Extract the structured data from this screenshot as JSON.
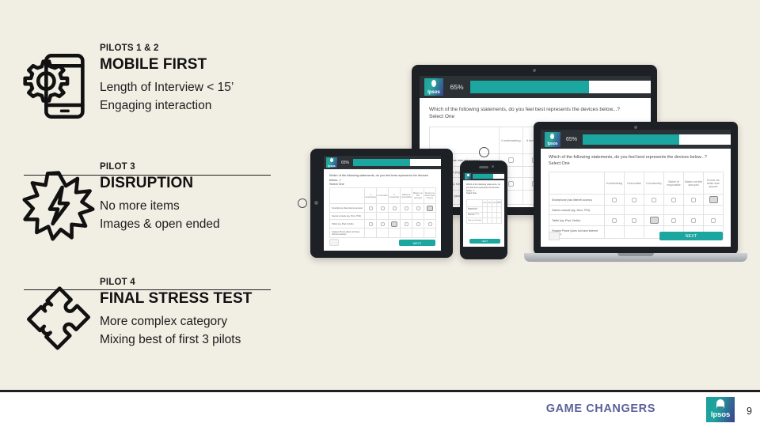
{
  "slide": {
    "background_color": "#F1EEE4",
    "page_number": "9"
  },
  "sections": [
    {
      "kicker": "PILOTS 1 & 2",
      "headline": "MOBILE FIRST",
      "body_line_1": "Length of Interview < 15’",
      "body_line_2": "Engaging interaction",
      "icon": "smartphone-gear-icon"
    },
    {
      "kicker": "PILOT 3",
      "headline": "DISRUPTION",
      "body_line_1": "No more items",
      "body_line_2": "Images & open ended",
      "icon": "starburst-lightning-icon"
    },
    {
      "kicker": "PILOT 4",
      "headline": "FINAL STRESS TEST",
      "body_line_1": "More complex category",
      "body_line_2": "Mixing best of first 3 pilots",
      "icon": "puzzle-pieces-icon"
    }
  ],
  "devices": {
    "survey": {
      "brand": "Ipsos",
      "progress_label": "65%",
      "progress_percent": 65,
      "question": "Which of the following statements, do you feel best represents the devices below...?",
      "instruction": "Select One",
      "columns": [
        "It entertaining",
        "It innovative",
        "It trustworthy",
        "Stable Hi responsible",
        "Makes me feel annoyed",
        "Knows me better than anyone"
      ],
      "rows": [
        "Smartphone (has internet access)",
        "Games console (eg. Xbox, PS4)",
        "Tablet (eg. iPad, Kindle)",
        "Feature Phone (does not have internet access)"
      ],
      "next_label": "NEXT",
      "accent_color": "#1BA6A0",
      "header_color": "#2C3136"
    },
    "items": [
      {
        "name": "tablet-top",
        "type": "tablet"
      },
      {
        "name": "tablet-left",
        "type": "tablet"
      },
      {
        "name": "smartphone-center",
        "type": "phone"
      },
      {
        "name": "laptop-right",
        "type": "laptop"
      }
    ]
  },
  "footer": {
    "tagline": "GAME CHANGERS",
    "tagline_color": "#5A6199",
    "logo_text": "Ipsos",
    "page_number": "9"
  }
}
